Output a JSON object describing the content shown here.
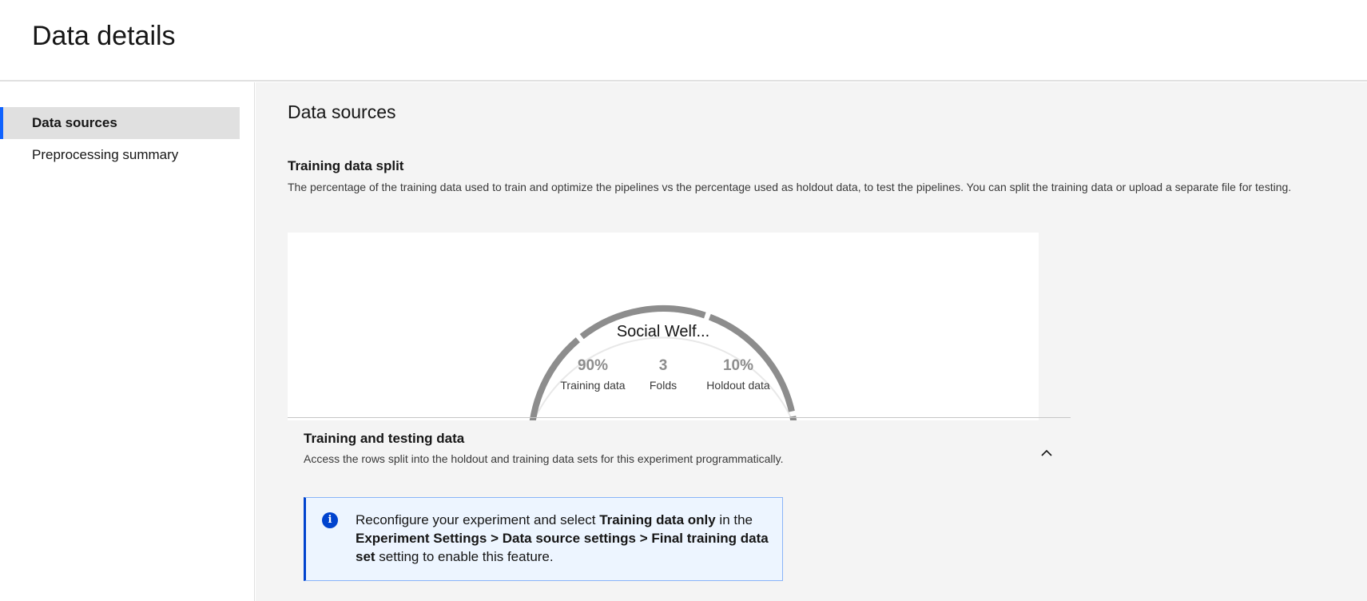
{
  "header": {
    "title": "Data details"
  },
  "sidebar": {
    "items": [
      {
        "label": "Data sources",
        "active": true
      },
      {
        "label": "Preprocessing summary",
        "active": false
      }
    ]
  },
  "main": {
    "section_title": "Data sources",
    "split": {
      "title": "Training data split",
      "description": "The percentage of the training data used to train and optimize the pipelines vs the percentage used as holdout data, to test the pipelines. You can split the training data or upload a separate file for testing."
    },
    "gauge": {
      "dataset_name": "Social Welf...",
      "training_fraction": 0.9,
      "folds_count": 3,
      "stats": [
        {
          "value": "90%",
          "label": "Training data"
        },
        {
          "value": "3",
          "label": "Folds"
        },
        {
          "value": "10%",
          "label": "Holdout data"
        }
      ],
      "colors": {
        "arc": "#8d8d8d",
        "track": "#e8e8e8"
      }
    },
    "training_testing": {
      "title": "Training and testing data",
      "description": "Access the rows split into the holdout and training data sets for this experiment programmatically.",
      "expanded": true
    },
    "notice": {
      "icon": "info-icon",
      "text_1": "Reconfigure your experiment and select ",
      "bold_1": "Training data only",
      "text_2": " in the ",
      "bold_2": "Experiment Settings > Data source settings > Final training data set",
      "text_3": " setting to enable this feature.",
      "accent": "#0043ce"
    }
  }
}
